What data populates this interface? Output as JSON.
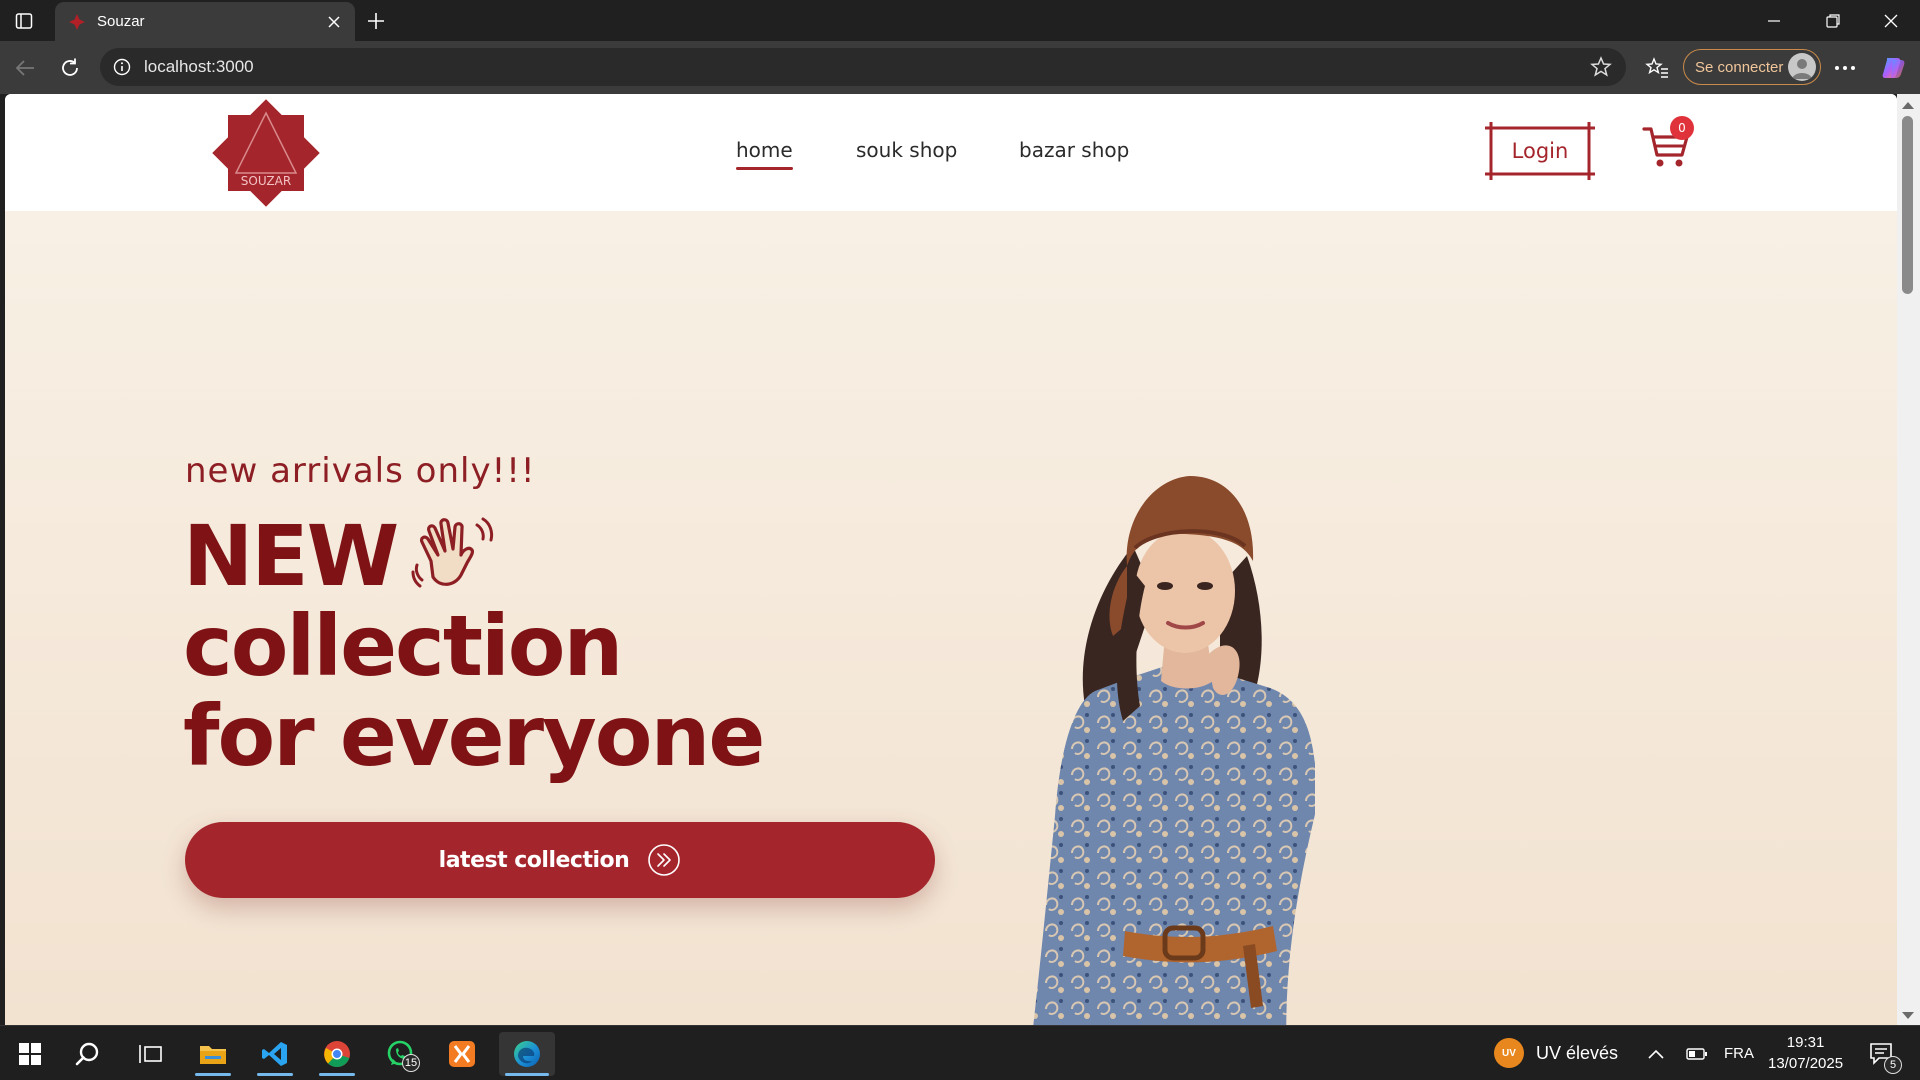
{
  "browser": {
    "tab_title": "Souzar",
    "url": "localhost:3000",
    "signin_label": "Se connecter"
  },
  "site": {
    "logo_text": "SOUZAR",
    "nav": [
      {
        "label": "home",
        "active": true
      },
      {
        "label": "souk shop",
        "active": false
      },
      {
        "label": "bazar shop",
        "active": false
      }
    ],
    "login_label": "Login",
    "cart_count": "0",
    "hero": {
      "subtitle": "new arrivals only!!!",
      "title_line1": "NEW",
      "title_line2": "collection",
      "title_line3": "for everyone",
      "cta_label": "latest collection"
    }
  },
  "taskbar": {
    "whatsapp_badge": "15",
    "weather_text": "UV élevés",
    "weather_badge": "UV",
    "language": "FRA",
    "time": "19:31",
    "date": "13/07/2025",
    "notifications": "5"
  },
  "colors": {
    "brand": "#a4262c",
    "title": "#7e1214",
    "hero_bg": "#f5e8da"
  }
}
